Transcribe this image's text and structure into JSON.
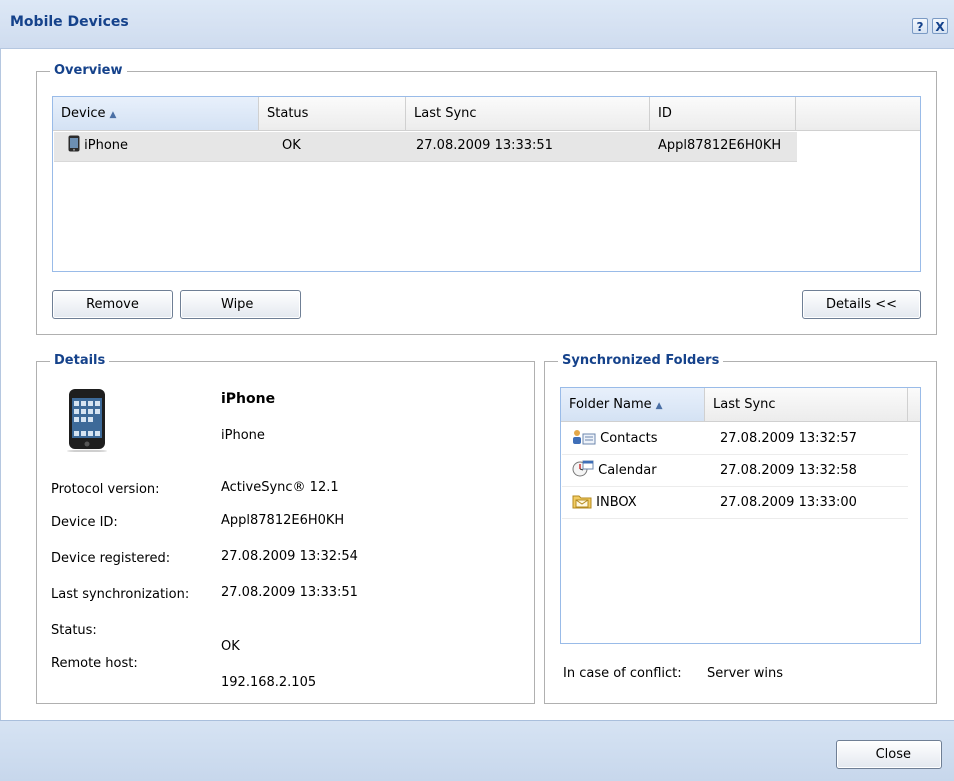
{
  "window": {
    "title": "Mobile Devices",
    "help_label": "?",
    "close_label": "X"
  },
  "overview": {
    "legend": "Overview",
    "columns": [
      "Device",
      "Status",
      "Last Sync",
      "ID"
    ],
    "sort_indicator": "▲",
    "rows": [
      {
        "device": "iPhone",
        "status": "OK",
        "last_sync": "27.08.2009 13:33:51",
        "id": "Appl87812E6H0KH"
      }
    ],
    "remove_label": "Remove",
    "wipe_label": "Wipe",
    "details_toggle_label": "Details <<"
  },
  "details": {
    "legend": "Details",
    "device_name": "iPhone",
    "device_model": "iPhone",
    "fields": [
      {
        "label": "Protocol version:",
        "value": "ActiveSync® 12.1"
      },
      {
        "label": "Device ID:",
        "value": "Appl87812E6H0KH"
      },
      {
        "label": "Device registered:",
        "value": "27.08.2009 13:32:54"
      },
      {
        "label": "Last synchronization:",
        "value": "27.08.2009 13:33:51"
      },
      {
        "label": "Status:",
        "value": "OK"
      },
      {
        "label": "Remote host:",
        "value": "192.168.2.105"
      }
    ]
  },
  "sync_folders": {
    "legend": "Synchronized Folders",
    "columns": [
      "Folder Name",
      "Last Sync"
    ],
    "sort_indicator": "▲",
    "rows": [
      {
        "icon": "contacts-icon",
        "name": "Contacts",
        "last_sync": "27.08.2009 13:32:57"
      },
      {
        "icon": "calendar-icon",
        "name": "Calendar",
        "last_sync": "27.08.2009 13:32:58"
      },
      {
        "icon": "inbox-icon",
        "name": "INBOX",
        "last_sync": "27.08.2009 13:33:00"
      }
    ],
    "conflict_label": "In case of conflict:",
    "conflict_value": "Server wins"
  },
  "footer": {
    "close_label": "Close"
  }
}
